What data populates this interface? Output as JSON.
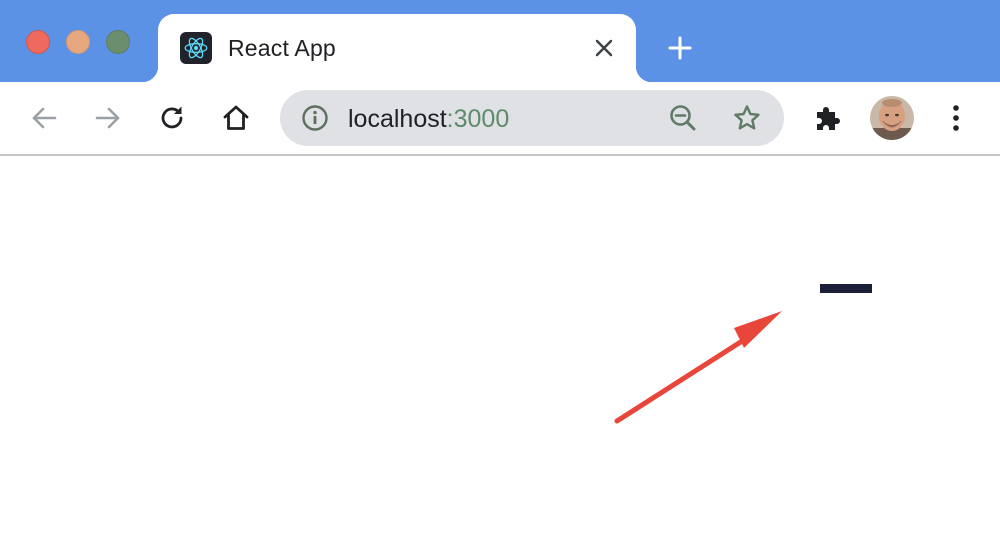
{
  "browser": {
    "tab": {
      "title": "React App",
      "favicon": "react-logo-icon"
    },
    "address_bar": {
      "host": "localhost",
      "port": ":3000"
    },
    "icons": {
      "back": "arrow-left-icon",
      "forward": "arrow-right-icon",
      "reload": "reload-icon",
      "home": "home-icon",
      "site_info": "info-icon",
      "zoom": "zoom-out-icon",
      "bookmark": "star-icon",
      "extensions": "puzzle-icon",
      "profile": "avatar",
      "menu": "kebab-menu-icon"
    },
    "colors": {
      "tabstrip": "#5b92e5",
      "traffic_close": "#ee6a5f",
      "traffic_minimize": "#e8a87f",
      "traffic_maximize": "#6b8e6e",
      "port_text": "#5f8a6c"
    }
  },
  "page": {
    "elements": [
      {
        "name": "menu-dash",
        "color": "#1c1f38"
      },
      {
        "name": "annotation-arrow",
        "color": "#e8463a"
      }
    ]
  }
}
